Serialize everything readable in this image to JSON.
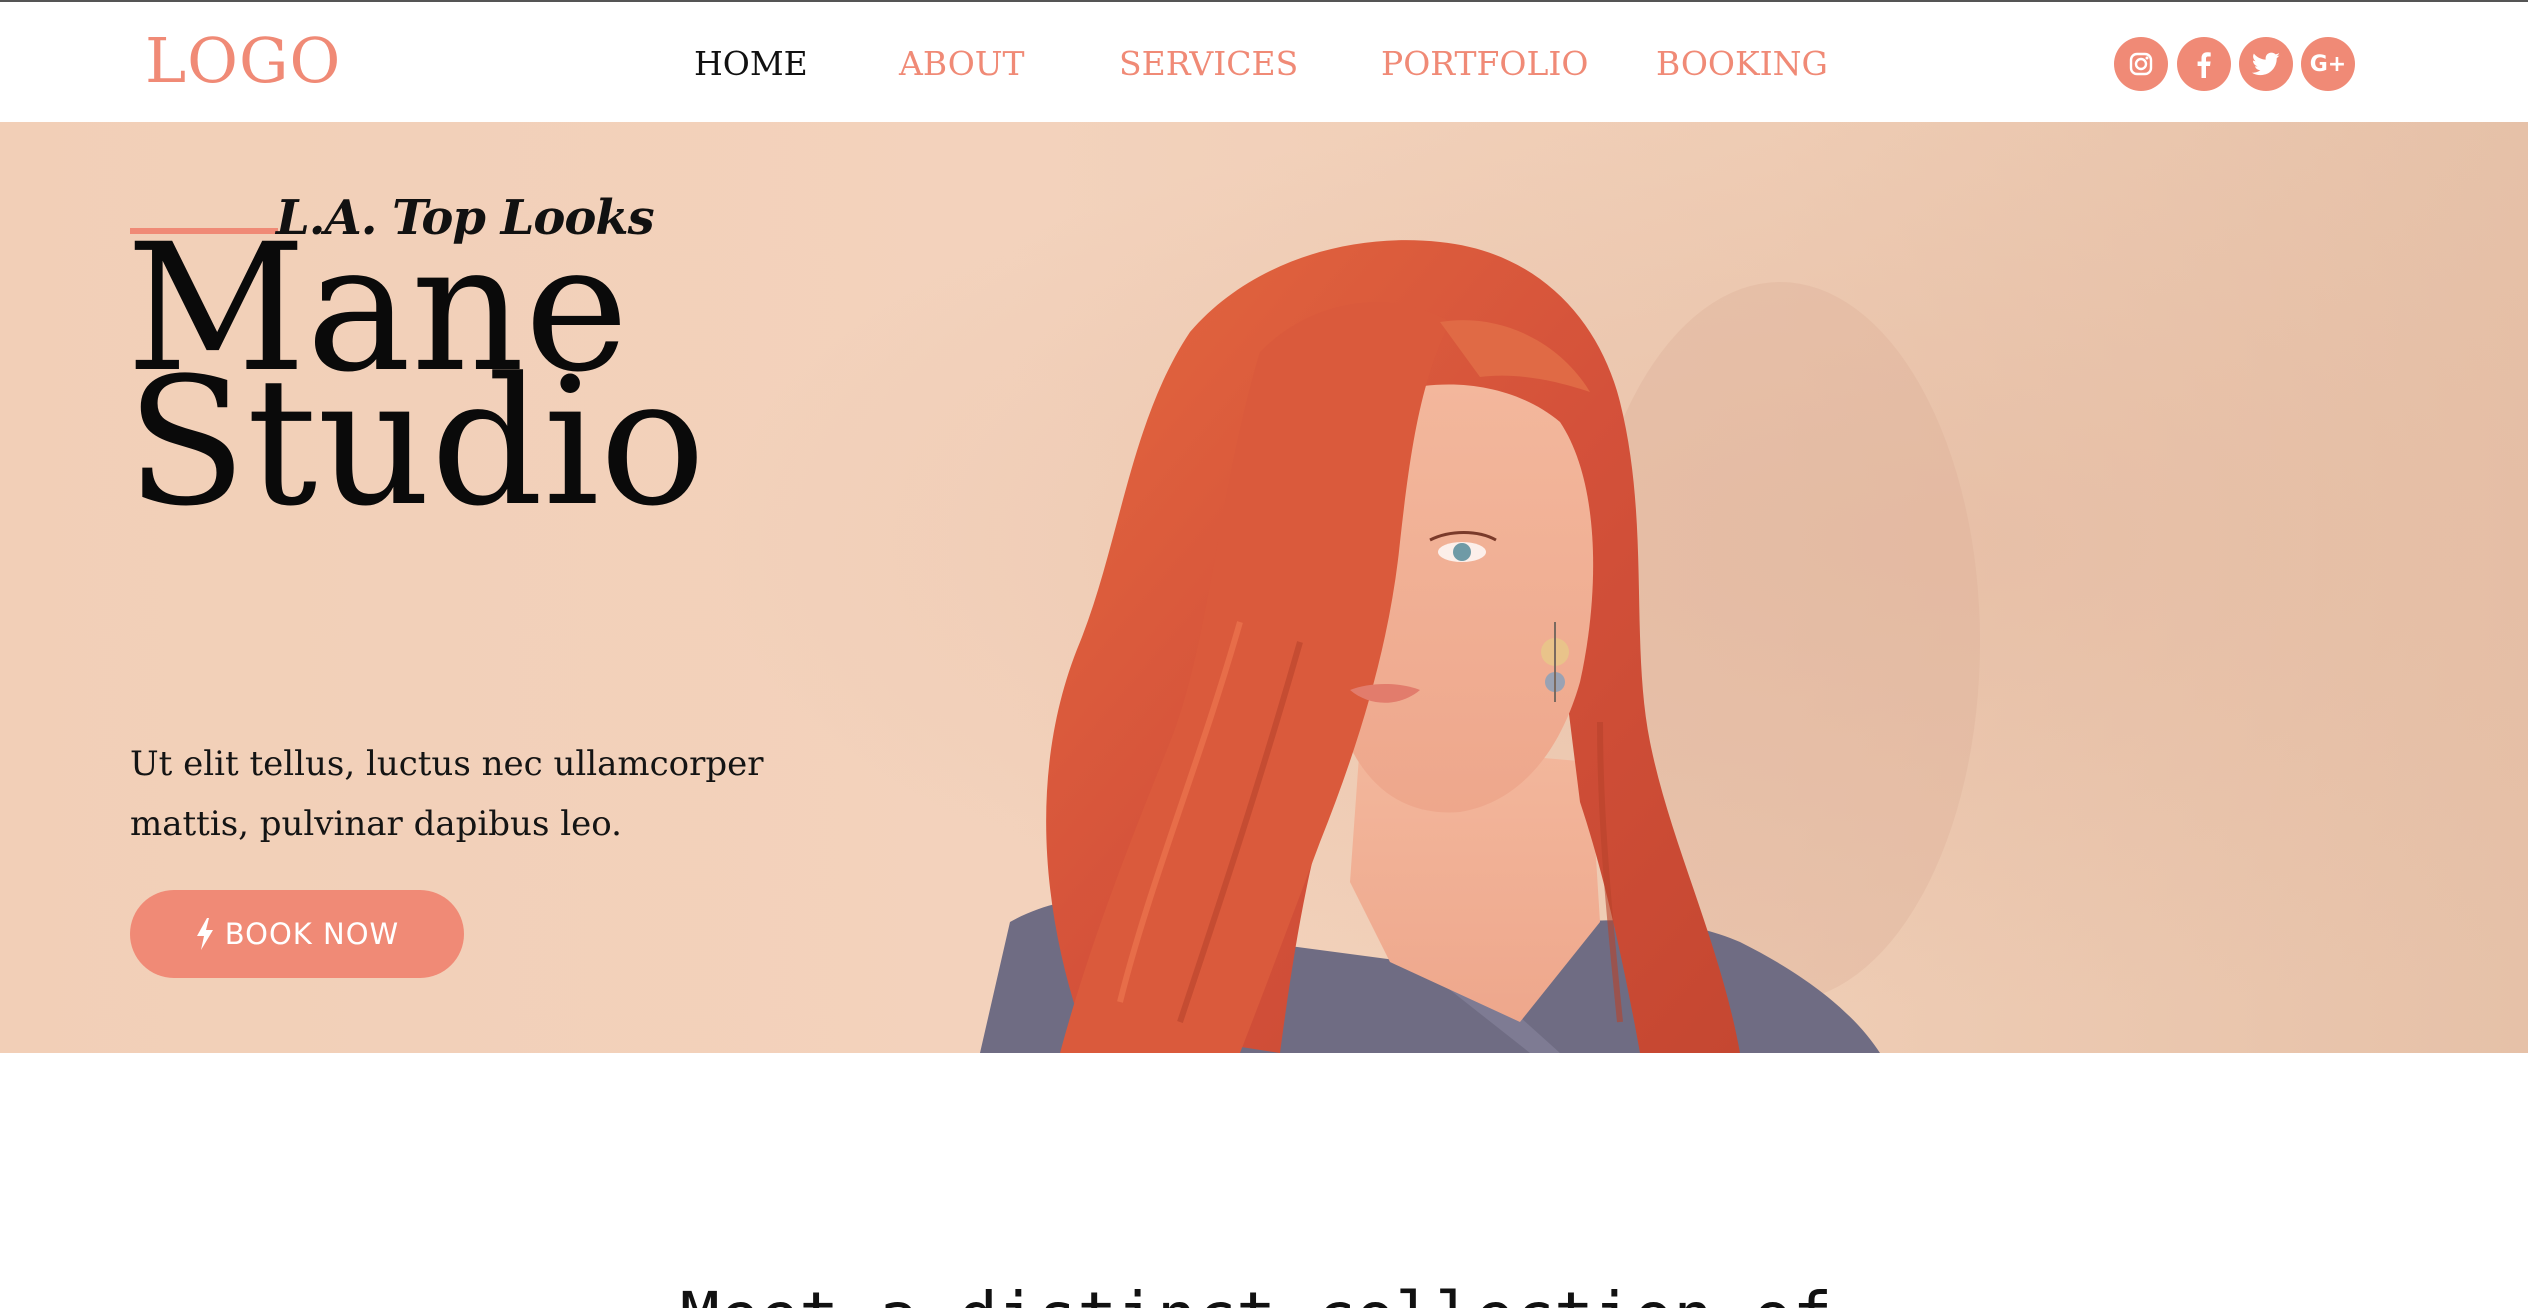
{
  "brand": {
    "logo": "LOGO"
  },
  "nav": {
    "items": [
      {
        "label": "HOME",
        "active": true
      },
      {
        "label": "ABOUT",
        "active": false
      },
      {
        "label": "SERVICES",
        "active": false
      },
      {
        "label": "PORTFOLIO",
        "active": false
      },
      {
        "label": "BOOKING",
        "active": false
      }
    ]
  },
  "social": [
    {
      "icon": "instagram-icon",
      "glyph": "◎"
    },
    {
      "icon": "facebook-icon",
      "glyph": "f"
    },
    {
      "icon": "twitter-icon",
      "glyph": "🐦"
    },
    {
      "icon": "google-plus-icon",
      "glyph": "G+"
    }
  ],
  "hero": {
    "tagline": "L.A. Top Looks",
    "title_line1": "Mane",
    "title_line2": "Studio",
    "description": "Ut elit tellus, luctus nec ullamcorper mattis, pulvinar dapibus leo.",
    "cta_label": "BOOK NOW",
    "cta_icon": "bolt-icon"
  },
  "section": {
    "heading_partial": "Meet a distinct collection of"
  },
  "colors": {
    "accent": "#f08a76",
    "hero_bg": "#f2cfb7",
    "text_dark": "#111111",
    "hair": "#d8583d"
  }
}
